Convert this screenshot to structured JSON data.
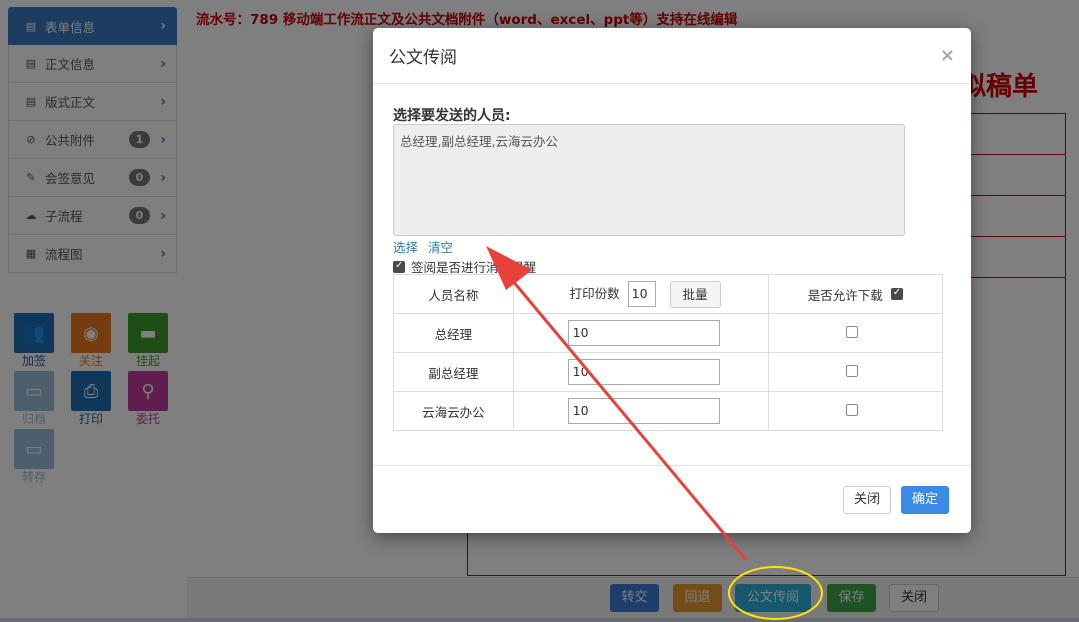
{
  "sidebar": {
    "items": [
      {
        "icon": "form-icon",
        "glyph": "▤",
        "label": "表单信息",
        "badge": ""
      },
      {
        "icon": "document-icon",
        "glyph": "▤",
        "label": "正文信息",
        "badge": ""
      },
      {
        "icon": "layout-icon",
        "glyph": "▤",
        "label": "版式正文",
        "badge": ""
      },
      {
        "icon": "paperclip-icon",
        "glyph": "⊘",
        "label": "公共附件",
        "badge": "1"
      },
      {
        "icon": "pencil-icon",
        "glyph": "✎",
        "label": "会签意见",
        "badge": "0"
      },
      {
        "icon": "cloud-icon",
        "glyph": "☁",
        "label": "子流程",
        "badge": "0"
      },
      {
        "icon": "grid-icon",
        "glyph": "▦",
        "label": "流程图",
        "badge": ""
      }
    ]
  },
  "tools": [
    {
      "label": "加签",
      "color": "#1f6fb2",
      "glyph": "👥"
    },
    {
      "label": "关注",
      "color": "#e8781e",
      "glyph": "◉"
    },
    {
      "label": "挂起",
      "color": "#3f9a2c",
      "glyph": "▬"
    },
    {
      "label": "归档",
      "color": "#9bbdd8",
      "glyph": "▭"
    },
    {
      "label": "打印",
      "color": "#1f6fb2",
      "glyph": "⎙"
    },
    {
      "label": "委托",
      "color": "#c03aa0",
      "glyph": "⚲"
    },
    {
      "label": "转存",
      "color": "#9bbdd8",
      "glyph": "▭"
    }
  ],
  "header": {
    "flow_title": "流水号：789  移动端工作流正文及公共文档附件（word、excel、ppt等）支持在线编辑",
    "doc_heading": "拟稿单"
  },
  "bottom_bar": {
    "transfer": "转交",
    "return": "回退",
    "circulate": "公文传阅",
    "save": "保存",
    "close": "关闭"
  },
  "modal": {
    "title": "公文传阅",
    "close_glyph": "×",
    "recipients_label": "选择要发送的人员:",
    "recipients_value": "总经理,副总经理,云海云办公",
    "select_link": "选择",
    "clear_link": "清空",
    "remind_label": "签阅是否进行消息提醒",
    "remind_checked": true,
    "table": {
      "col_name": "人员名称",
      "col_copies": "打印份数",
      "copies_default": "10",
      "batch_button": "批量",
      "col_download": "是否允许下载",
      "rows": [
        {
          "name": "总经理",
          "copies": "10",
          "download": false
        },
        {
          "name": "副总经理",
          "copies": "10",
          "download": false
        },
        {
          "name": "云海云办公",
          "copies": "10",
          "download": false
        }
      ]
    },
    "footer": {
      "close": "关闭",
      "ok": "确定"
    }
  },
  "colors": {
    "accent": "#3879c0",
    "title_red": "#cc0000",
    "annotation_arrow": "#e8413c",
    "annotation_ellipse": "#ffe500"
  }
}
